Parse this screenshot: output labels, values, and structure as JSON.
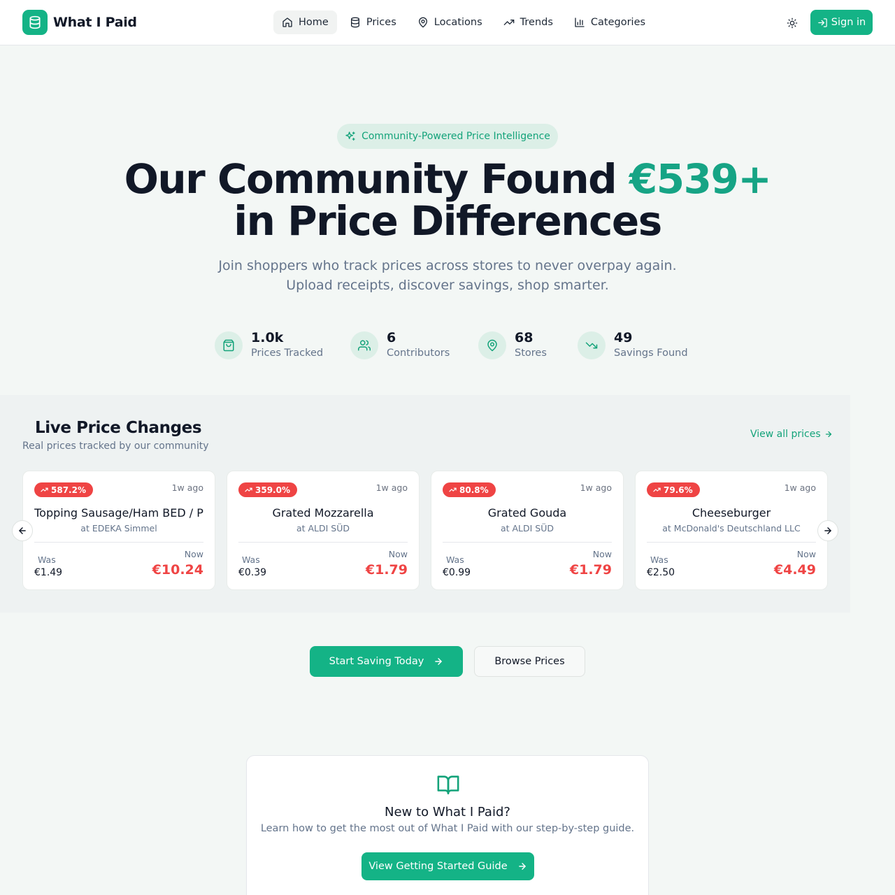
{
  "brand": {
    "name": "What I Paid",
    "icon": "database-icon",
    "accent": "#14b386"
  },
  "nav": {
    "items": [
      {
        "label": "Home",
        "icon": "home-icon",
        "active": true
      },
      {
        "label": "Prices",
        "icon": "database-icon"
      },
      {
        "label": "Locations",
        "icon": "map-pin-icon"
      },
      {
        "label": "Trends",
        "icon": "trending-up-icon"
      },
      {
        "label": "Categories",
        "icon": "bar-chart-icon"
      }
    ],
    "theme_toggle_icon": "sun-icon",
    "signin_label": "Sign in"
  },
  "hero": {
    "badge": "Community-Powered Price Intelligence",
    "headline_prefix": "Our Community Found",
    "headline_amount": "€539+",
    "headline_suffix": "in Price Differences",
    "sub_line1": "Join shoppers who track prices across stores to never overpay again.",
    "sub_line2": "Upload receipts, discover savings, shop smarter."
  },
  "stats": [
    {
      "value": "1.0k",
      "label": "Prices Tracked",
      "icon": "shopping-bag-icon"
    },
    {
      "value": "6",
      "label": "Contributors",
      "icon": "users-icon"
    },
    {
      "value": "68",
      "label": "Stores",
      "icon": "map-pin-icon"
    },
    {
      "value": "49",
      "label": "Savings Found",
      "icon": "trending-down-icon"
    }
  ],
  "live": {
    "title": "Live Price Changes",
    "subtitle": "Real prices tracked by our community",
    "view_all": "View all prices",
    "was_label": "Was",
    "now_label": "Now",
    "cards": [
      {
        "pct": "587.2%",
        "ago": "1w ago",
        "name": "Topping Sausage/Ham BED / P",
        "store": "at EDEKA Simmel",
        "was": "€1.49",
        "now": "€10.24"
      },
      {
        "pct": "359.0%",
        "ago": "1w ago",
        "name": "Grated Mozzarella",
        "store": "at ALDI SÜD",
        "was": "€0.39",
        "now": "€1.79"
      },
      {
        "pct": "80.8%",
        "ago": "1w ago",
        "name": "Grated Gouda",
        "store": "at ALDI SÜD",
        "was": "€0.99",
        "now": "€1.79"
      },
      {
        "pct": "79.6%",
        "ago": "1w ago",
        "name": "Cheeseburger",
        "store": "at McDonald's Deutschland LLC",
        "was": "€2.50",
        "now": "€4.49"
      }
    ]
  },
  "cta": {
    "primary": "Start Saving Today",
    "secondary": "Browse Prices"
  },
  "guide": {
    "icon": "book-open-icon",
    "title": "New to What I Paid?",
    "subtitle": "Learn how to get the most out of What I Paid with our step-by-step guide.",
    "button": "View Getting Started Guide"
  },
  "colors": {
    "accent": "#14b386",
    "price_up": "#ef4444",
    "muted": "#64748b"
  }
}
